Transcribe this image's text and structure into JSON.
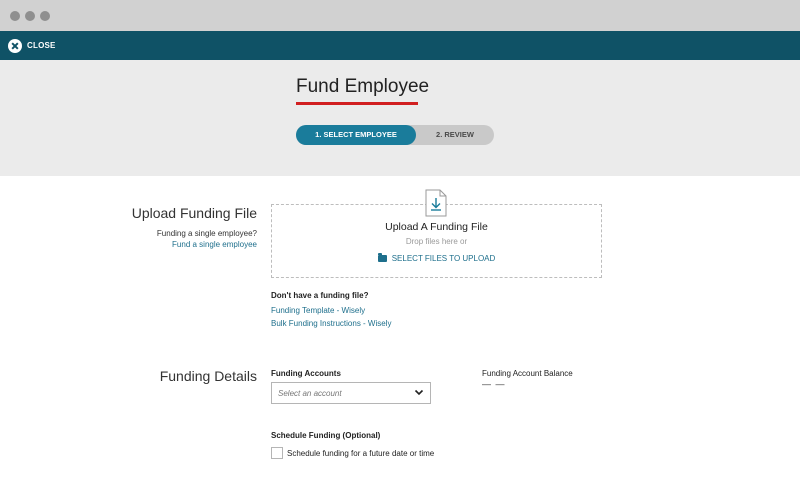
{
  "window": {
    "dots": [
      "dot",
      "dot",
      "dot"
    ]
  },
  "topbar": {
    "close_label": "CLOSE",
    "close_icon": "close-circle-icon"
  },
  "header": {
    "title": "Fund Employee",
    "steps": [
      {
        "label": "1. SELECT EMPLOYEE",
        "active": true
      },
      {
        "label": "2. REVIEW",
        "active": false
      }
    ],
    "accent_color": "#d11f20",
    "step_active_color": "#1a7c9b"
  },
  "upload": {
    "section_title": "Upload Funding File",
    "single_question": "Funding a single employee?",
    "single_link": "Fund a single employee",
    "drop_icon": "document-download-icon",
    "drop_title": "Upload A Funding File",
    "drop_subtitle": "Drop files here or",
    "select_files_label": "SELECT FILES TO UPLOAD",
    "select_files_icon": "folder-open-icon",
    "no_file_question": "Don't have a funding file?",
    "links": [
      "Funding Template - Wisely",
      "Bulk Funding Instructions - Wisely"
    ]
  },
  "details": {
    "section_title": "Funding Details",
    "accounts_label": "Funding Accounts",
    "accounts_placeholder": "Select an account",
    "balance_label": "Funding Account Balance",
    "balance_value": "— —",
    "schedule_label": "Schedule Funding (Optional)",
    "schedule_checkbox_label": "Schedule funding for a future date or time",
    "schedule_checked": false
  },
  "colors": {
    "brand_bar": "#0f5266",
    "link": "#1e6f8c"
  }
}
